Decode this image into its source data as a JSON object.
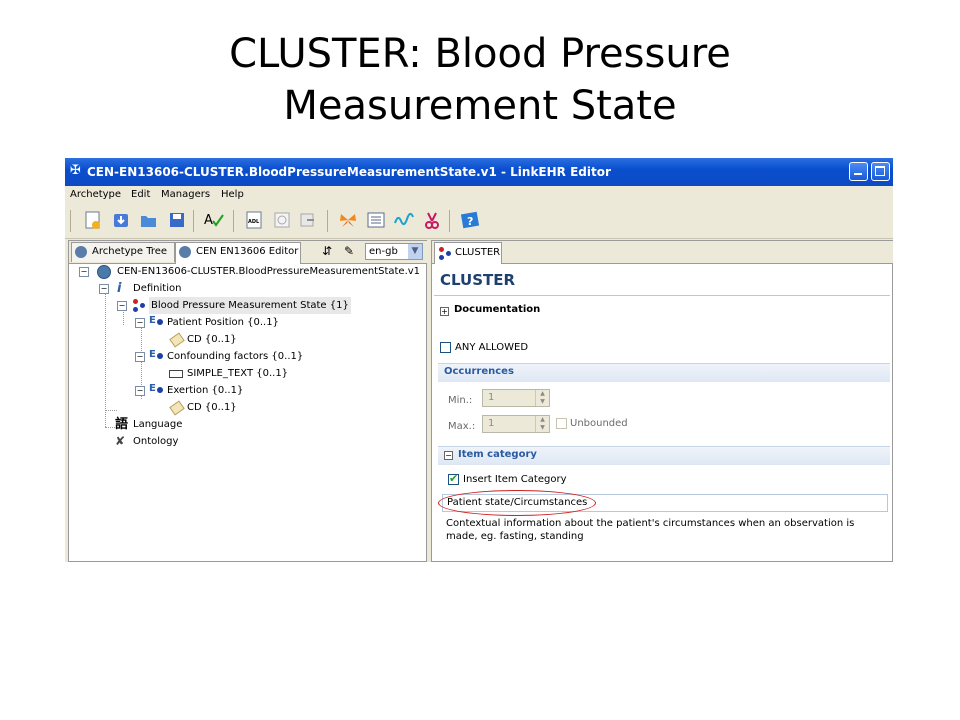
{
  "slide": {
    "title_line1": "CLUSTER: Blood Pressure",
    "title_line2": "Measurement State"
  },
  "window": {
    "title": "CEN-EN13606-CLUSTER.BloodPressureMeasurementState.v1 - LinkEHR Editor",
    "icon": "app-logo-icon"
  },
  "menu": [
    "Archetype",
    "Edit",
    "Managers",
    "Help"
  ],
  "toolbar": {
    "icons": [
      "new-archetype-icon",
      "import-icon",
      "open-folder-icon",
      "save-icon",
      "spellcheck-icon",
      "adl-icon",
      "validate-icon",
      "export-icon",
      "butterfly-icon",
      "list-icon",
      "wave-icon",
      "scissors-icon",
      "help-icon"
    ],
    "adl_label": "ADL"
  },
  "left_tabs": {
    "tab1": "Archetype Tree",
    "tab2": "CEN EN13606 Editor"
  },
  "language": {
    "selected": "en-gb"
  },
  "tree": {
    "root": "CEN-EN13606-CLUSTER.BloodPressureMeasurementState.v1",
    "definition": "Definition",
    "cluster": "Blood Pressure Measurement State {1}",
    "patient_position": "Patient Position {0..1}",
    "pp_cd": "CD {0..1}",
    "confounding": "Confounding factors {0..1}",
    "cf_text": "SIMPLE_TEXT {0..1}",
    "exertion": "Exertion {0..1}",
    "ex_cd": "CD {0..1}",
    "language": "Language",
    "ontology": "Ontology",
    "language_glyph": "語"
  },
  "right": {
    "tab": "CLUSTER",
    "heading": "CLUSTER",
    "documentation": "Documentation",
    "any_allowed": "ANY ALLOWED",
    "occurrences": {
      "header": "Occurrences",
      "min_label": "Min.:",
      "min_value": "1",
      "max_label": "Max.:",
      "max_value": "1",
      "unbounded": "Unbounded"
    },
    "item_category": {
      "header": "Item category",
      "insert_label": "Insert Item Category",
      "insert_checked": true,
      "value": "Patient state/Circumstances",
      "description": "Contextual information about the patient's circumstances when an observation is made, eg. fasting, standing"
    }
  },
  "colors": {
    "title_bar": "#0a4fcf",
    "highlight_ellipse": "#d02020",
    "form_heading": "#1f3f6e"
  }
}
